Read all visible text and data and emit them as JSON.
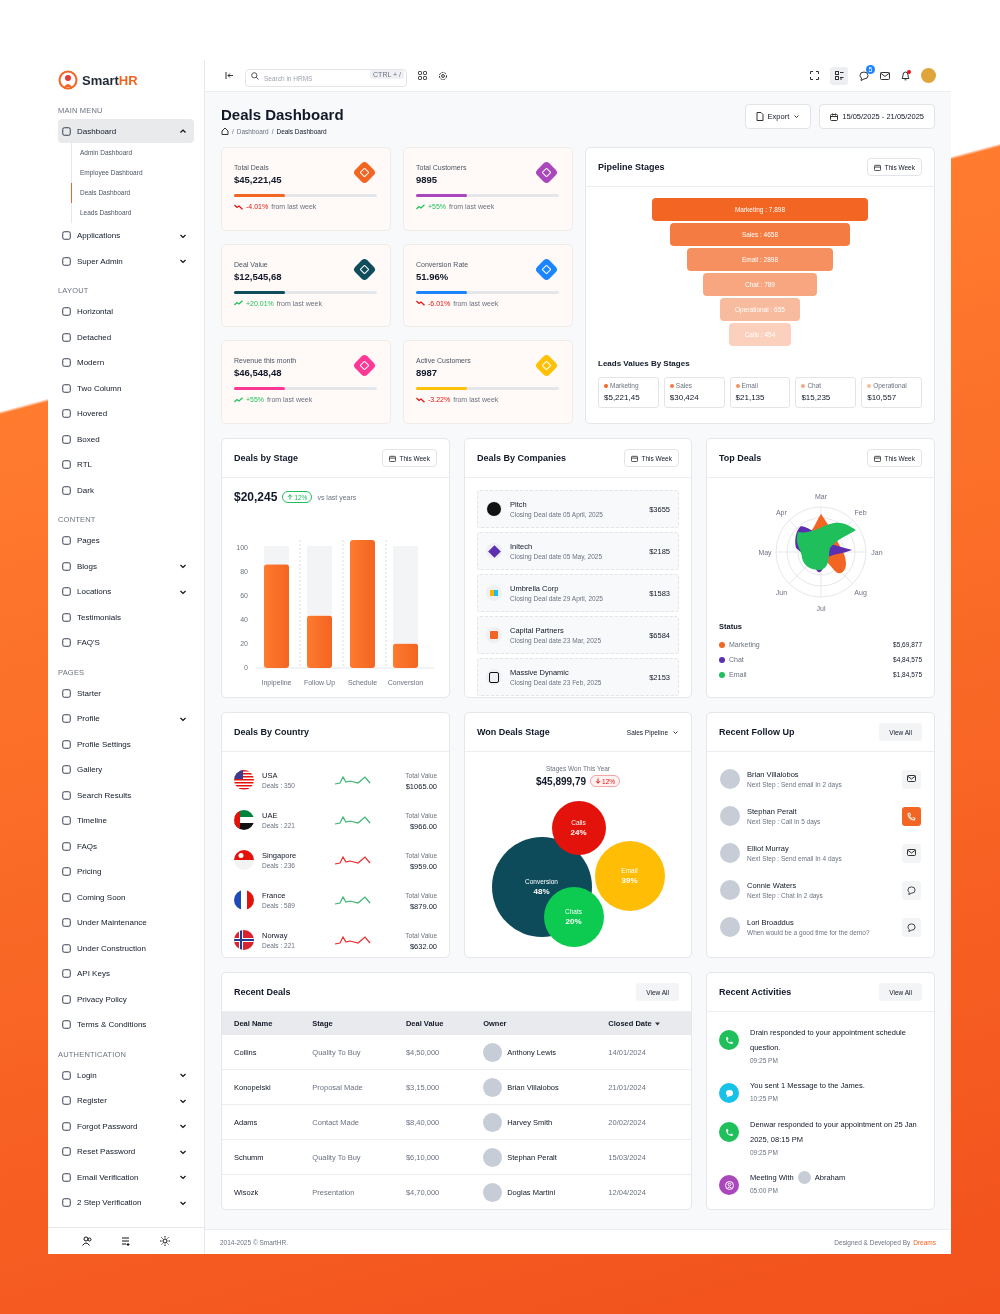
{
  "brand": {
    "name": "Smart",
    "accent": "HR"
  },
  "sidebar": {
    "sections": [
      {
        "title": "MAIN MENU",
        "items": [
          {
            "label": "Dashboard",
            "selected": true,
            "expanded": true,
            "children": [
              {
                "label": "Admin Dashboard",
                "selected": false
              },
              {
                "label": "Employee Dashboard",
                "selected": false
              },
              {
                "label": "Deals Dashboard",
                "selected": true
              },
              {
                "label": "Leads Dashboard",
                "selected": false
              }
            ]
          },
          {
            "label": "Applications",
            "selected": false,
            "expanded": false
          },
          {
            "label": "Super Admin",
            "selected": false,
            "expanded": false
          }
        ]
      },
      {
        "title": "LAYOUT",
        "items": [
          {
            "label": "Horizontal",
            "selected": false
          },
          {
            "label": "Detached",
            "selected": false
          },
          {
            "label": "Modern",
            "selected": false
          },
          {
            "label": "Two Column",
            "selected": false
          },
          {
            "label": "Hovered",
            "selected": false
          },
          {
            "label": "Boxed",
            "selected": false
          },
          {
            "label": "RTL",
            "selected": false
          },
          {
            "label": "Dark",
            "selected": false
          }
        ]
      },
      {
        "title": "CONTENT",
        "items": [
          {
            "label": "Pages",
            "selected": false
          },
          {
            "label": "Blogs",
            "selected": false,
            "expanded": false
          },
          {
            "label": "Locations",
            "selected": false,
            "expanded": false
          },
          {
            "label": "Testimonials",
            "selected": false
          },
          {
            "label": "FAQ'S",
            "selected": false
          }
        ]
      },
      {
        "title": "PAGES",
        "items": [
          {
            "label": "Starter",
            "selected": false
          },
          {
            "label": "Profile",
            "selected": false,
            "expanded": false
          },
          {
            "label": "Profile Settings",
            "selected": false
          },
          {
            "label": "Gallery",
            "selected": false
          },
          {
            "label": "Search Results",
            "selected": false
          },
          {
            "label": "Timeline",
            "selected": false
          },
          {
            "label": "FAQs",
            "selected": false
          },
          {
            "label": "Pricing",
            "selected": false
          },
          {
            "label": "Coming Soon",
            "selected": false
          },
          {
            "label": "Under Maintenance",
            "selected": false
          },
          {
            "label": "Under Construction",
            "selected": false
          },
          {
            "label": "API Keys",
            "selected": false
          },
          {
            "label": "Privacy Policy",
            "selected": false
          },
          {
            "label": "Terms & Conditions",
            "selected": false
          }
        ]
      },
      {
        "title": "AUTHENTICATION",
        "items": [
          {
            "label": "Login",
            "selected": false,
            "expanded": false
          },
          {
            "label": "Register",
            "selected": false,
            "expanded": false
          },
          {
            "label": "Forgot Password",
            "selected": false,
            "expanded": false
          },
          {
            "label": "Reset Password",
            "selected": false,
            "expanded": false
          },
          {
            "label": "Email Verification",
            "selected": false,
            "expanded": false
          },
          {
            "label": "2 Step Verification",
            "selected": false,
            "expanded": false
          }
        ]
      }
    ]
  },
  "topbar": {
    "search_placeholder": "Search in HRMS",
    "shortcut": "CTRL + /",
    "chat_badge": "5",
    "bell_alert": true
  },
  "page": {
    "title": "Deals Dashboard",
    "breadcrumb": [
      {
        "separator": "/",
        "label": "Dashboard"
      },
      {
        "separator": "/",
        "label": "Deals Dashboard"
      }
    ],
    "export": "Export",
    "date_range": "15/05/2025 - 21/05/2025"
  },
  "stats": [
    {
      "label": "Total Deals",
      "value": "$45,221,45",
      "level": 0.36,
      "color": "#f26522",
      "change": "-4.01%",
      "rising": false,
      "note": "from last week"
    },
    {
      "label": "Total Customers",
      "value": "9895",
      "level": 0.36,
      "color": "#ab47bc",
      "change": "+55%",
      "rising": true,
      "note": "from last week"
    },
    {
      "label": "Deal Value",
      "value": "$12,545,68",
      "level": 0.36,
      "color": "#0f4c5c",
      "change": "+20.01%",
      "rising": true,
      "note": "from last week"
    },
    {
      "label": "Conversion Rate",
      "value": "51.96%",
      "level": 0.36,
      "color": "#1b84ff",
      "change": "-6.01%",
      "rising": false,
      "note": "from last week"
    },
    {
      "label": "Revenue this month",
      "value": "$46,548,48",
      "level": 0.36,
      "color": "#fd3995",
      "change": "+55%",
      "rising": true,
      "note": "from last week"
    },
    {
      "label": "Active Customers",
      "value": "8987",
      "level": 0.36,
      "color": "#ffc107",
      "change": "-3.22%",
      "rising": false,
      "note": "from last week"
    }
  ],
  "pipeline": {
    "title": "Pipeline Stages",
    "period": "This Week",
    "stages": [
      "Marketing : 7,898",
      "Sales : 4658",
      "Email : 2898",
      "Chat : 789",
      "Operational : 655",
      "Calls : 454"
    ],
    "leads_title": "Leads Values By Stages",
    "leads": [
      {
        "name": "Marketing",
        "value": "$5,221,45"
      },
      {
        "name": "Sales",
        "value": "$30,424"
      },
      {
        "name": "Email",
        "value": "$21,135"
      },
      {
        "name": "Chat",
        "value": "$15,235"
      },
      {
        "name": "Operational",
        "value": "$10,557"
      }
    ]
  },
  "deals_by_stage": {
    "title": "Deals by Stage",
    "period": "This Week",
    "total": "$20,245",
    "badge": "12%",
    "note": "vs last years",
    "chart_data": {
      "type": "bar",
      "categories": [
        "Inpipeline",
        "Follow Up",
        "Schedule",
        "Conversion"
      ],
      "stacked": true,
      "series": [
        {
          "color": "#f26522",
          "values": [
            85,
            43,
            105,
            20
          ]
        },
        {
          "color": "#f3f4f6",
          "values": [
            15,
            57,
            null,
            80
          ]
        }
      ],
      "ylim": [
        0,
        105
      ],
      "yticks": [
        0,
        20,
        40,
        60,
        80,
        100
      ]
    }
  },
  "companies": {
    "title": "Deals By Companies",
    "period": "This Week",
    "items": [
      {
        "name": "Pitch",
        "date": "Closing Deal date 05 April, 2025",
        "amount": "$3655"
      },
      {
        "name": "Initech",
        "date": "Closing Deal date 05 May, 2025",
        "amount": "$2185"
      },
      {
        "name": "Umbrella Corp",
        "date": "Closing Deal date 29 April, 2025",
        "amount": "$1583"
      },
      {
        "name": "Capital Partners",
        "date": "Closing Deal date 23 Mar, 2025",
        "amount": "$6584"
      },
      {
        "name": "Massive Dynamic",
        "date": "Closing Deal date 23 Feb, 2025",
        "amount": "$2153"
      }
    ]
  },
  "top_deals": {
    "title": "Top Deals",
    "period": "This Week",
    "axis_labels": [
      "Jan",
      "Feb",
      "Mar",
      "Apr",
      "May",
      "Jun",
      "Jul",
      "Aug"
    ],
    "status_title": "Status",
    "legend": [
      {
        "name": "Marketing",
        "color": "#f26522",
        "value": "$5,69,877"
      },
      {
        "name": "Chat",
        "color": "#5b2fb0",
        "value": "$4,84,575"
      },
      {
        "name": "Email",
        "color": "#1fbf5c",
        "value": "$1,84,575"
      }
    ]
  },
  "countries": {
    "title": "Deals By Country",
    "items": [
      {
        "name": "USA",
        "deals": "Deals : 350",
        "value_label": "Total Value",
        "value": "$1065.00",
        "color": "#3cb371"
      },
      {
        "name": "UAE",
        "deals": "Deals : 221",
        "value_label": "Total Value",
        "value": "$966.00",
        "color": "#3cb371"
      },
      {
        "name": "Singapore",
        "deals": "Deals : 236",
        "value_label": "Total Value",
        "value": "$959.00",
        "color": "#ef2b2b"
      },
      {
        "name": "France",
        "deals": "Deals : 589",
        "value_label": "Total Value",
        "value": "$879.00",
        "color": "#3cb371"
      },
      {
        "name": "Norway",
        "deals": "Deals : 221",
        "value_label": "Total Value",
        "value": "$632.00",
        "color": "#ef2b2b"
      }
    ]
  },
  "won": {
    "title": "Won Deals Stage",
    "pipeline": "Sales Pipeline",
    "subtitle": "Stages Won This Year",
    "total": "$45,899,79",
    "badge": "12%",
    "bubbles": [
      {
        "label": "Conversion",
        "pct": "48%",
        "color": "#0d4a5a"
      },
      {
        "label": "Calls",
        "pct": "24%",
        "color": "#e3120b"
      },
      {
        "label": "Email",
        "pct": "39%",
        "color": "#ffbd05"
      },
      {
        "label": "Chats",
        "pct": "20%",
        "color": "#0ccb50"
      }
    ]
  },
  "followups": {
    "title": "Recent Follow Up",
    "view_all": "View All",
    "items": [
      {
        "name": "Brian Villalobos",
        "note": "Next Step : Send email In 2 days",
        "kind": "email"
      },
      {
        "name": "Stephan Peralt",
        "note": "Next Step :  Call In 5 days",
        "kind": "call"
      },
      {
        "name": "Elliot Murray",
        "note": "Next Step : Send email In 4 days",
        "kind": "email"
      },
      {
        "name": "Connie Waters",
        "note": "Next Step : Chat In 2 days",
        "kind": "chat"
      },
      {
        "name": "Lori Broaddus",
        "note": "When would be a good time for the demo?",
        "kind": "chat"
      }
    ]
  },
  "recent_deals": {
    "title": "Recent Deals",
    "view_all": "View All",
    "columns": [
      {
        "label": "Deal Name",
        "sorted": false
      },
      {
        "label": "Stage",
        "sorted": false
      },
      {
        "label": "Deal Value",
        "sorted": false
      },
      {
        "label": "Owner",
        "sorted": false
      },
      {
        "label": "Closed Date",
        "sorted": true
      }
    ],
    "rows": [
      [
        "Collins",
        "Quality To Buy",
        "$4,50,000",
        "Anthony Lewis",
        "14/01/2024"
      ],
      [
        "Konopelski",
        "Proposal Made",
        "$3,15,000",
        "Brian Villalobos",
        "21/01/2024"
      ],
      [
        "Adams",
        "Contact Made",
        "$8,40,000",
        "Harvey Smith",
        "20/02/2024"
      ],
      [
        "Schumm",
        "Quality To Buy",
        "$6,10,000",
        "Stephan Peralt",
        "15/03/2024"
      ],
      [
        "Wisozk",
        "Presentation",
        "$4,70,000",
        "Doglas Martini",
        "12/04/2024"
      ]
    ]
  },
  "activities": {
    "title": "Recent Activities",
    "view_all": "View All",
    "items": [
      {
        "kind": "call",
        "text": "Drain responded to your appointment schedule question.",
        "time": "09:25 PM"
      },
      {
        "kind": "message",
        "text": "You sent 1 Message to the James.",
        "time": "10:25 PM"
      },
      {
        "kind": "call",
        "text": "Denwar responded to your appointment on 25 Jan 2025, 08:15 PM",
        "time": "09:25 PM"
      },
      {
        "kind": "meeting",
        "text": "Meeting With",
        "with": "Abraham",
        "time": "05:00 PM"
      }
    ]
  },
  "footer": {
    "copyright": "2014-2025 © SmartHR.",
    "credit": "Designed & Developed By",
    "credit_link": "Dreams"
  }
}
